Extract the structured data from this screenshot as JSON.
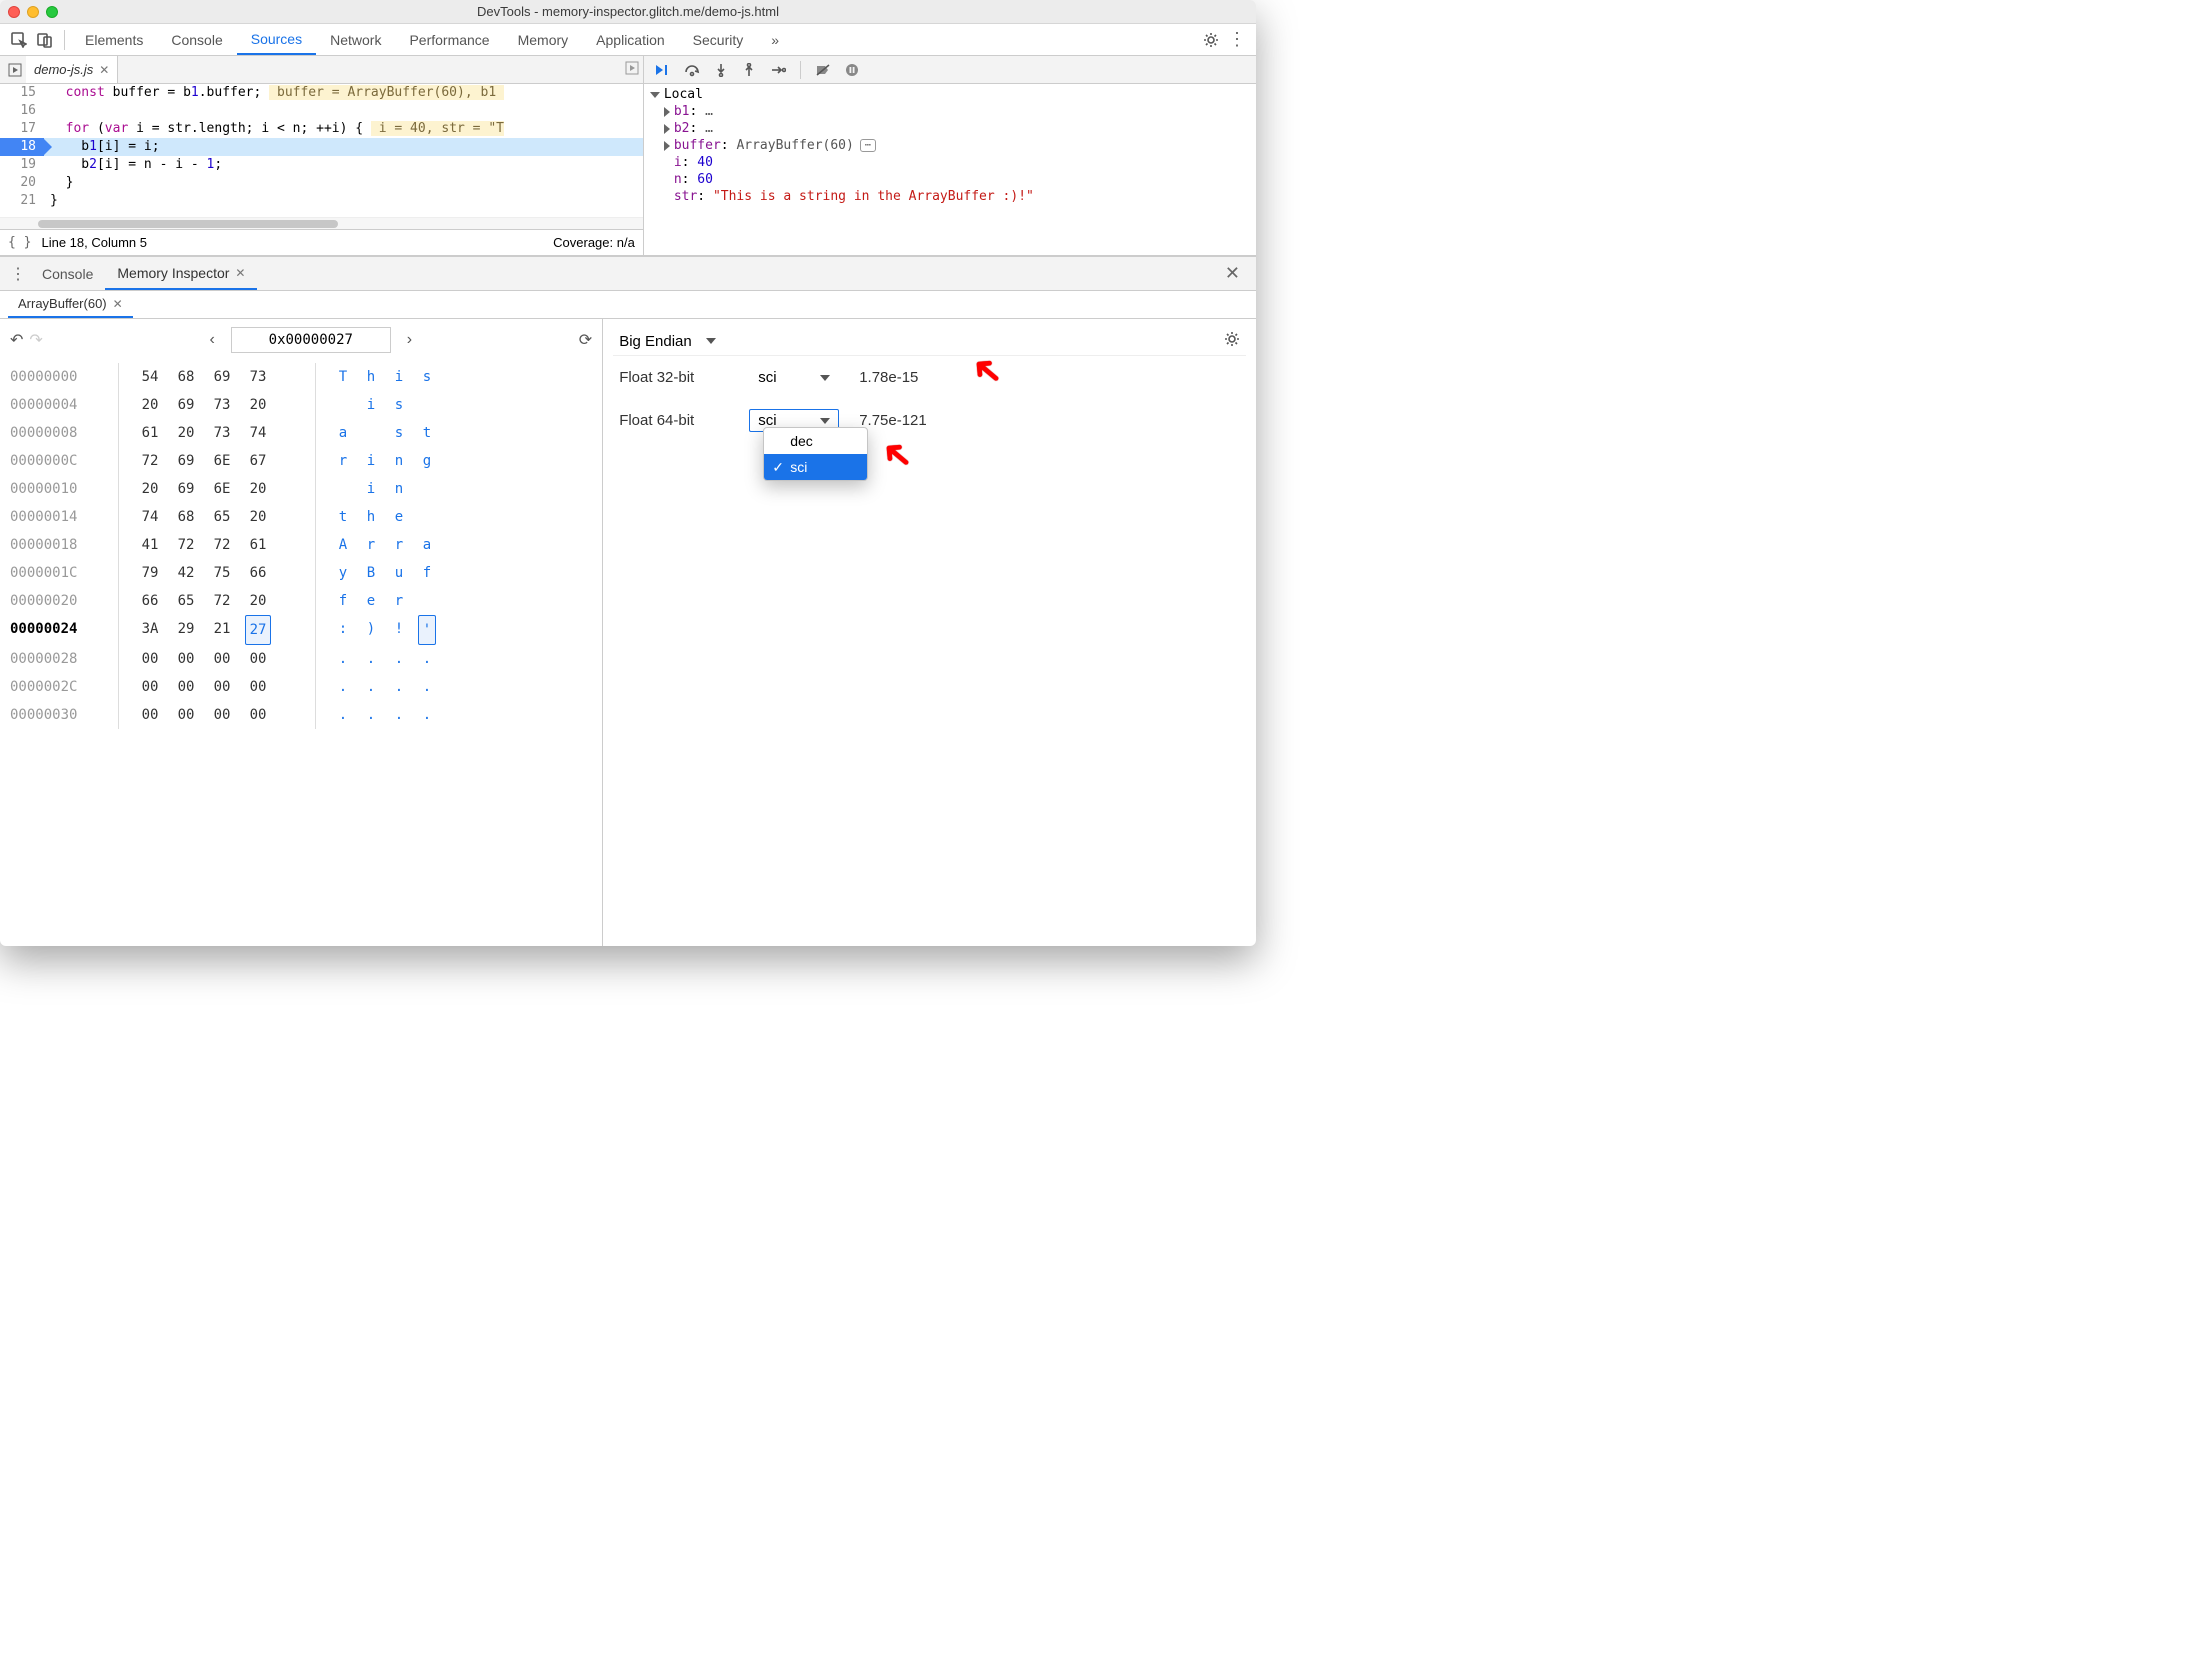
{
  "window": {
    "title": "DevTools - memory-inspector.glitch.me/demo-js.html"
  },
  "mainTabs": {
    "items": [
      "Elements",
      "Console",
      "Sources",
      "Network",
      "Performance",
      "Memory",
      "Application",
      "Security"
    ],
    "active": "Sources",
    "overflow": "»"
  },
  "fileTabs": {
    "active": "demo-js.js"
  },
  "code": {
    "lines": [
      {
        "n": 15,
        "text": "  const buffer = b1.buffer;",
        "hint": " buffer = ArrayBuffer(60), b1 "
      },
      {
        "n": 16,
        "text": ""
      },
      {
        "n": 17,
        "text": "  for (var i = str.length; i < n; ++i) {",
        "hint": " i = 40, str = \"T"
      },
      {
        "n": 18,
        "text": "    b1[i] = i;",
        "exec": true
      },
      {
        "n": 19,
        "text": "    b2[i] = n - i - 1;"
      },
      {
        "n": 20,
        "text": "  }"
      },
      {
        "n": 21,
        "text": "}"
      }
    ]
  },
  "statusline": {
    "pos": "Line 18, Column 5",
    "coverage": "Coverage: n/a"
  },
  "scope": {
    "header": "Local",
    "rows": [
      {
        "name": "b1",
        "val": "…"
      },
      {
        "name": "b2",
        "val": "…"
      },
      {
        "name": "buffer",
        "val": "ArrayBuffer(60)",
        "icon": true
      },
      {
        "name": "i",
        "val": "40",
        "num": true,
        "leaf": true
      },
      {
        "name": "n",
        "val": "60",
        "num": true,
        "leaf": true
      },
      {
        "name": "str",
        "val": "\"This is a string in the ArrayBuffer :)!\"",
        "str": true,
        "leaf": true
      }
    ]
  },
  "drawer": {
    "tabs": {
      "console": "Console",
      "mi": "Memory Inspector",
      "active": "mi"
    },
    "bufferTab": "ArrayBuffer(60)"
  },
  "mi": {
    "address": "0x00000027",
    "rows": [
      {
        "addr": "00000000",
        "b": [
          "54",
          "68",
          "69",
          "73"
        ],
        "a": [
          "T",
          "h",
          "i",
          "s"
        ]
      },
      {
        "addr": "00000004",
        "b": [
          "20",
          "69",
          "73",
          "20"
        ],
        "a": [
          " ",
          "i",
          "s",
          " "
        ]
      },
      {
        "addr": "00000008",
        "b": [
          "61",
          "20",
          "73",
          "74"
        ],
        "a": [
          "a",
          " ",
          "s",
          "t"
        ]
      },
      {
        "addr": "0000000C",
        "b": [
          "72",
          "69",
          "6E",
          "67"
        ],
        "a": [
          "r",
          "i",
          "n",
          "g"
        ]
      },
      {
        "addr": "00000010",
        "b": [
          "20",
          "69",
          "6E",
          "20"
        ],
        "a": [
          " ",
          "i",
          "n",
          " "
        ]
      },
      {
        "addr": "00000014",
        "b": [
          "74",
          "68",
          "65",
          "20"
        ],
        "a": [
          "t",
          "h",
          "e",
          " "
        ]
      },
      {
        "addr": "00000018",
        "b": [
          "41",
          "72",
          "72",
          "61"
        ],
        "a": [
          "A",
          "r",
          "r",
          "a"
        ]
      },
      {
        "addr": "0000001C",
        "b": [
          "79",
          "42",
          "75",
          "66"
        ],
        "a": [
          "y",
          "B",
          "u",
          "f"
        ]
      },
      {
        "addr": "00000020",
        "b": [
          "66",
          "65",
          "72",
          "20"
        ],
        "a": [
          "f",
          "e",
          "r",
          " "
        ]
      },
      {
        "addr": "00000024",
        "b": [
          "3A",
          "29",
          "21",
          "27"
        ],
        "a": [
          ":",
          ")",
          "!",
          "'"
        ],
        "bold": true,
        "sel": 3
      },
      {
        "addr": "00000028",
        "b": [
          "00",
          "00",
          "00",
          "00"
        ],
        "a": [
          ".",
          ".",
          ".",
          "."
        ]
      },
      {
        "addr": "0000002C",
        "b": [
          "00",
          "00",
          "00",
          "00"
        ],
        "a": [
          ".",
          ".",
          ".",
          "."
        ]
      },
      {
        "addr": "00000030",
        "b": [
          "00",
          "00",
          "00",
          "00"
        ],
        "a": [
          ".",
          ".",
          ".",
          "."
        ]
      }
    ]
  },
  "values": {
    "endian": "Big Endian",
    "float32": {
      "label": "Float 32-bit",
      "fmt": "sci",
      "val": "1.78e-15"
    },
    "float64": {
      "label": "Float 64-bit",
      "fmt": "sci",
      "val": "7.75e-121"
    },
    "dropdown": {
      "opts": [
        "dec",
        "sci"
      ],
      "selected": "sci"
    }
  }
}
